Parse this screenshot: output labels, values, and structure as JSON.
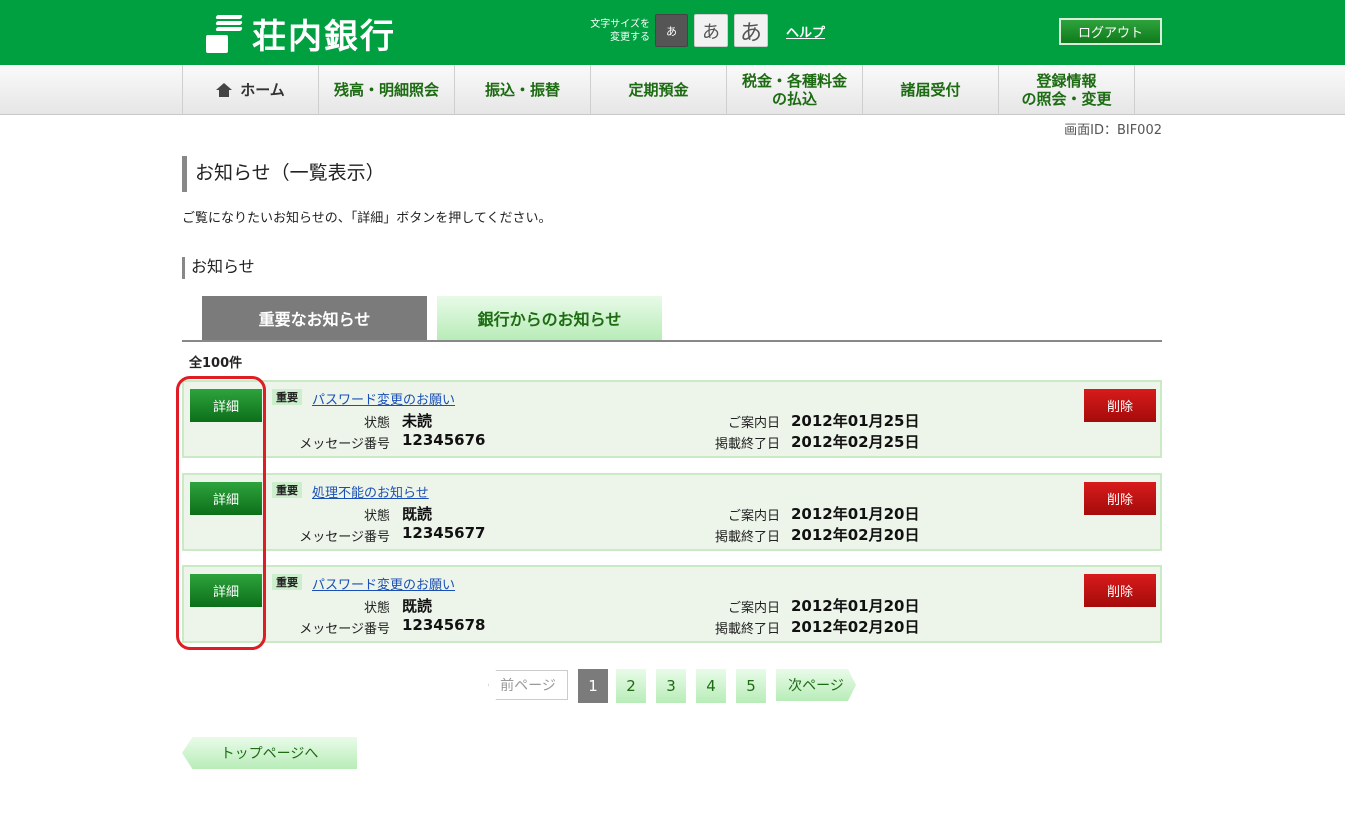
{
  "header": {
    "bank_name": "荘内銀行",
    "font_size_label_line1": "文字サイズを",
    "font_size_label_line2": "変更する",
    "font_small": "あ",
    "font_medium": "あ",
    "font_large": "あ",
    "help": "ヘルプ",
    "logout": "ログアウト"
  },
  "nav": {
    "items": [
      {
        "label": "ホーム"
      },
      {
        "label": "残高・明細照会"
      },
      {
        "label": "振込・振替"
      },
      {
        "label": "定期預金"
      },
      {
        "label_line1": "税金・各種料金",
        "label_line2": "の払込"
      },
      {
        "label": "諸届受付"
      },
      {
        "label_line1": "登録情報",
        "label_line2": "の照会・変更"
      }
    ]
  },
  "screen_id": "画面ID：BIF002",
  "page_title": "お知らせ（一覧表示）",
  "instruction": "ご覧になりたいお知らせの、「詳細」ボタンを押してください。",
  "section_title": "お知らせ",
  "tabs": [
    {
      "label": "重要なお知らせ",
      "active": true
    },
    {
      "label": "銀行からのお知らせ",
      "active": false
    }
  ],
  "count": "全100件",
  "labels": {
    "detail": "詳細",
    "badge": "重要",
    "status": "状態",
    "message_no": "メッセージ番号",
    "guide_date": "ご案内日",
    "end_date": "掲載終了日",
    "delete": "削除"
  },
  "notices": [
    {
      "subject": "パスワード変更のお願い",
      "status": "未読",
      "message_no": "12345676",
      "guide_date": "2012年01月25日",
      "end_date": "2012年02月25日"
    },
    {
      "subject": "処理不能のお知らせ",
      "status": "既読",
      "message_no": "12345677",
      "guide_date": "2012年01月20日",
      "end_date": "2012年02月20日"
    },
    {
      "subject": "パスワード変更のお願い",
      "status": "既読",
      "message_no": "12345678",
      "guide_date": "2012年01月20日",
      "end_date": "2012年02月20日"
    }
  ],
  "pagination": {
    "prev": "前ページ",
    "pages": [
      "1",
      "2",
      "3",
      "4",
      "5"
    ],
    "current": "1",
    "next": "次ページ"
  },
  "top_page": "トップページへ",
  "colors": {
    "header_green": "#00a040",
    "nav_text_green": "#1d6b12",
    "delete_red": "#c81414",
    "highlight_red": "#e01c24"
  }
}
